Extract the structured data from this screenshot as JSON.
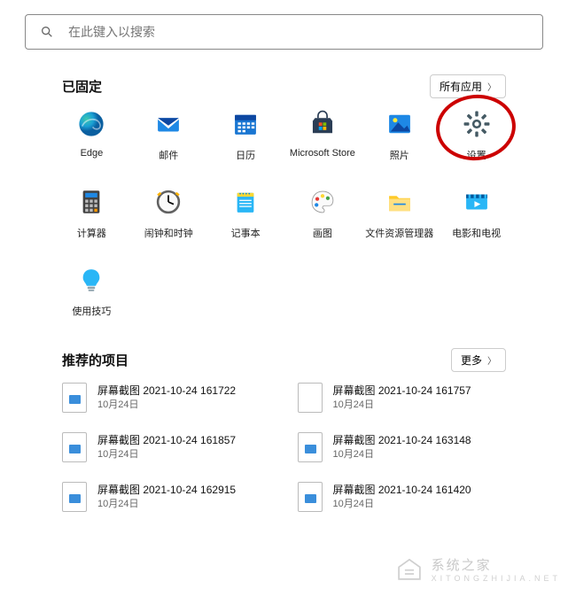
{
  "search": {
    "placeholder": "在此键入以搜索"
  },
  "pinned": {
    "title": "已固定",
    "all_apps_label": "所有应用",
    "apps": [
      {
        "key": "edge",
        "label": "Edge"
      },
      {
        "key": "mail",
        "label": "邮件"
      },
      {
        "key": "calendar",
        "label": "日历"
      },
      {
        "key": "store",
        "label": "Microsoft Store"
      },
      {
        "key": "photos",
        "label": "照片"
      },
      {
        "key": "settings",
        "label": "设置"
      },
      {
        "key": "calculator",
        "label": "计算器"
      },
      {
        "key": "clock",
        "label": "闹钟和时钟"
      },
      {
        "key": "notepad",
        "label": "记事本"
      },
      {
        "key": "paint",
        "label": "画图"
      },
      {
        "key": "explorer",
        "label": "文件资源管理器"
      },
      {
        "key": "movies",
        "label": "电影和电视"
      },
      {
        "key": "tips",
        "label": "使用技巧"
      }
    ]
  },
  "recommended": {
    "title": "推荐的项目",
    "more_label": "更多",
    "items": [
      {
        "name": "屏幕截图 2021-10-24 161722",
        "date": "10月24日",
        "blank": false
      },
      {
        "name": "屏幕截图 2021-10-24 161757",
        "date": "10月24日",
        "blank": true
      },
      {
        "name": "屏幕截图 2021-10-24 161857",
        "date": "10月24日",
        "blank": false
      },
      {
        "name": "屏幕截图 2021-10-24 163148",
        "date": "10月24日",
        "blank": false
      },
      {
        "name": "屏幕截图 2021-10-24 162915",
        "date": "10月24日",
        "blank": false
      },
      {
        "name": "屏幕截图 2021-10-24 161420",
        "date": "10月24日",
        "blank": false
      }
    ]
  },
  "watermark": {
    "main": "系统之家",
    "sub": "XITONGZHIJIA.NET"
  }
}
